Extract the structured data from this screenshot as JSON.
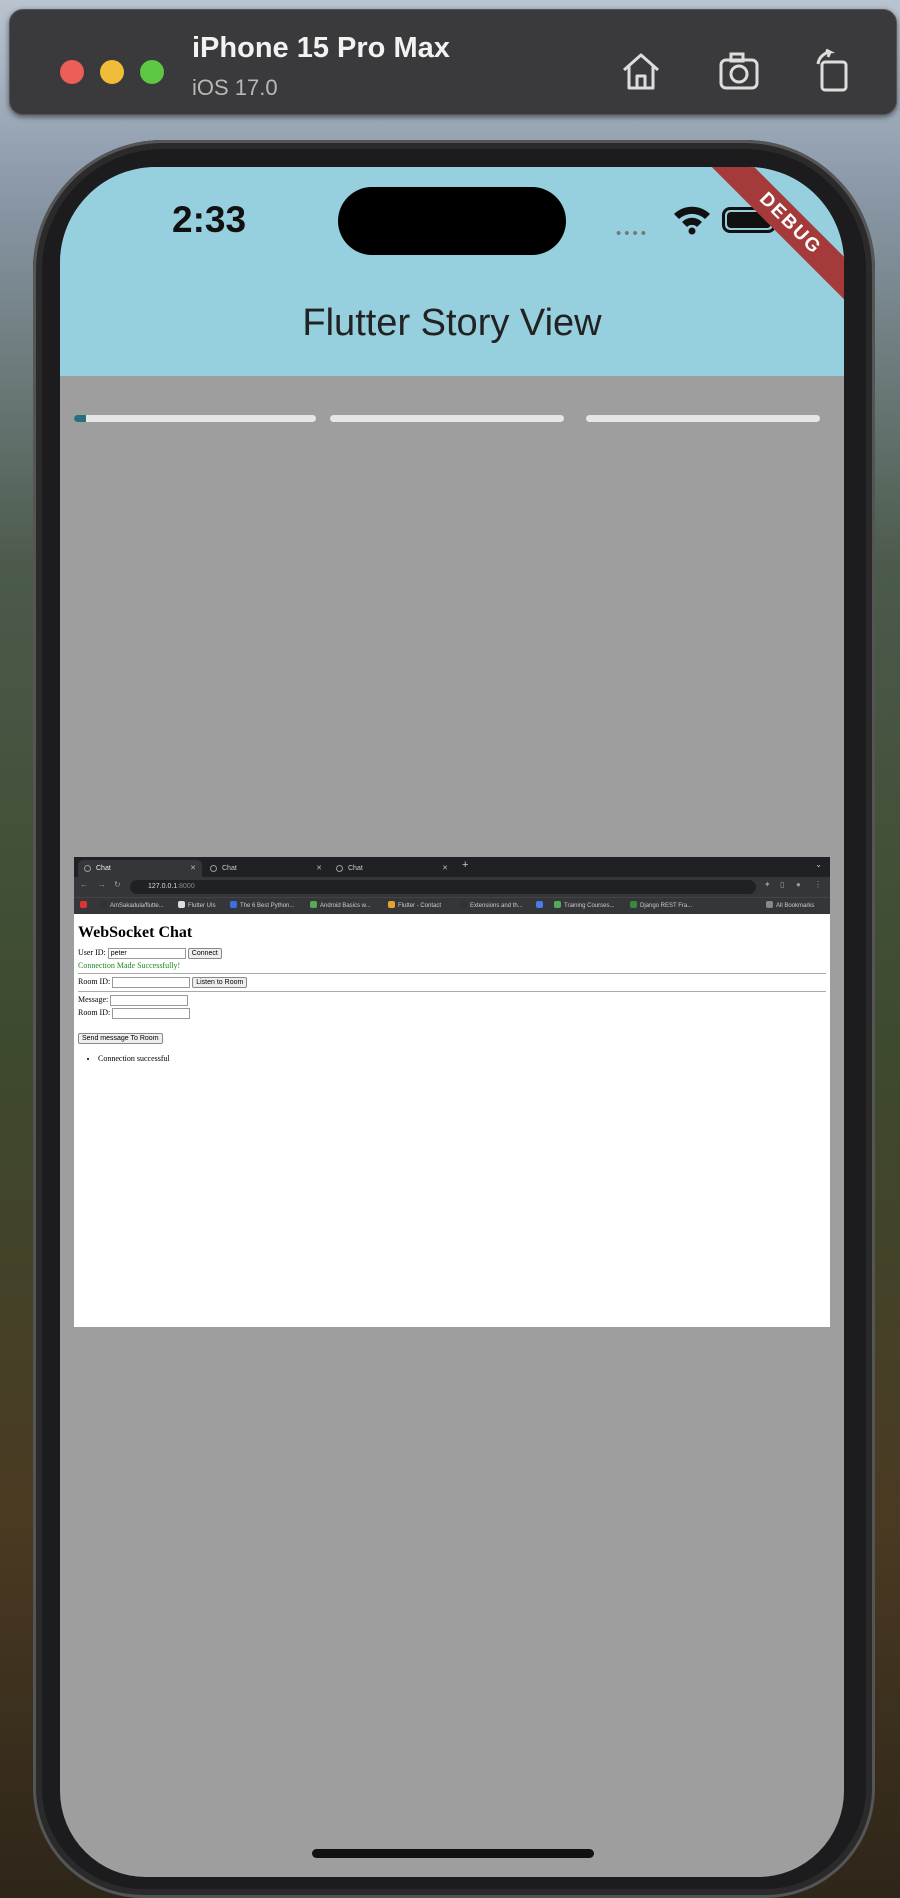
{
  "simulator": {
    "device_name": "iPhone 15 Pro Max",
    "os_version": "iOS 17.0",
    "icons": [
      "home-icon",
      "camera-icon",
      "rotate-icon"
    ]
  },
  "status_bar": {
    "time": "2:33",
    "signal_dots": "••••",
    "debug_banner": "DEBUG"
  },
  "app": {
    "title": "Flutter Story View",
    "story_progress": [
      0.05,
      0,
      0
    ]
  },
  "browser": {
    "tabs": [
      "Chat",
      "Chat",
      "Chat"
    ],
    "url_host": "127.0.0.1",
    "url_port": ":8000",
    "bookmarks": [
      "AmSakadula/flutte...",
      "Flutter UIs",
      "The 6 Best Python...",
      "Android Basics w...",
      "Flutter - Contact",
      "Extensions and th...",
      "Training Courses...",
      "Django REST Fra...",
      "All Bookmarks"
    ],
    "page": {
      "heading": "WebSocket Chat",
      "user_id_label": "User ID:",
      "user_id_value": "peter",
      "connect_label": "Connect",
      "success_text": "Connection Made Successfully!",
      "room_id_label": "Room ID:",
      "listen_label": "Listen to Room",
      "message_label": "Message:",
      "room_id_label_2": "Room ID:",
      "send_label": "Send message To Room",
      "messages": [
        "Connection successful"
      ]
    }
  }
}
